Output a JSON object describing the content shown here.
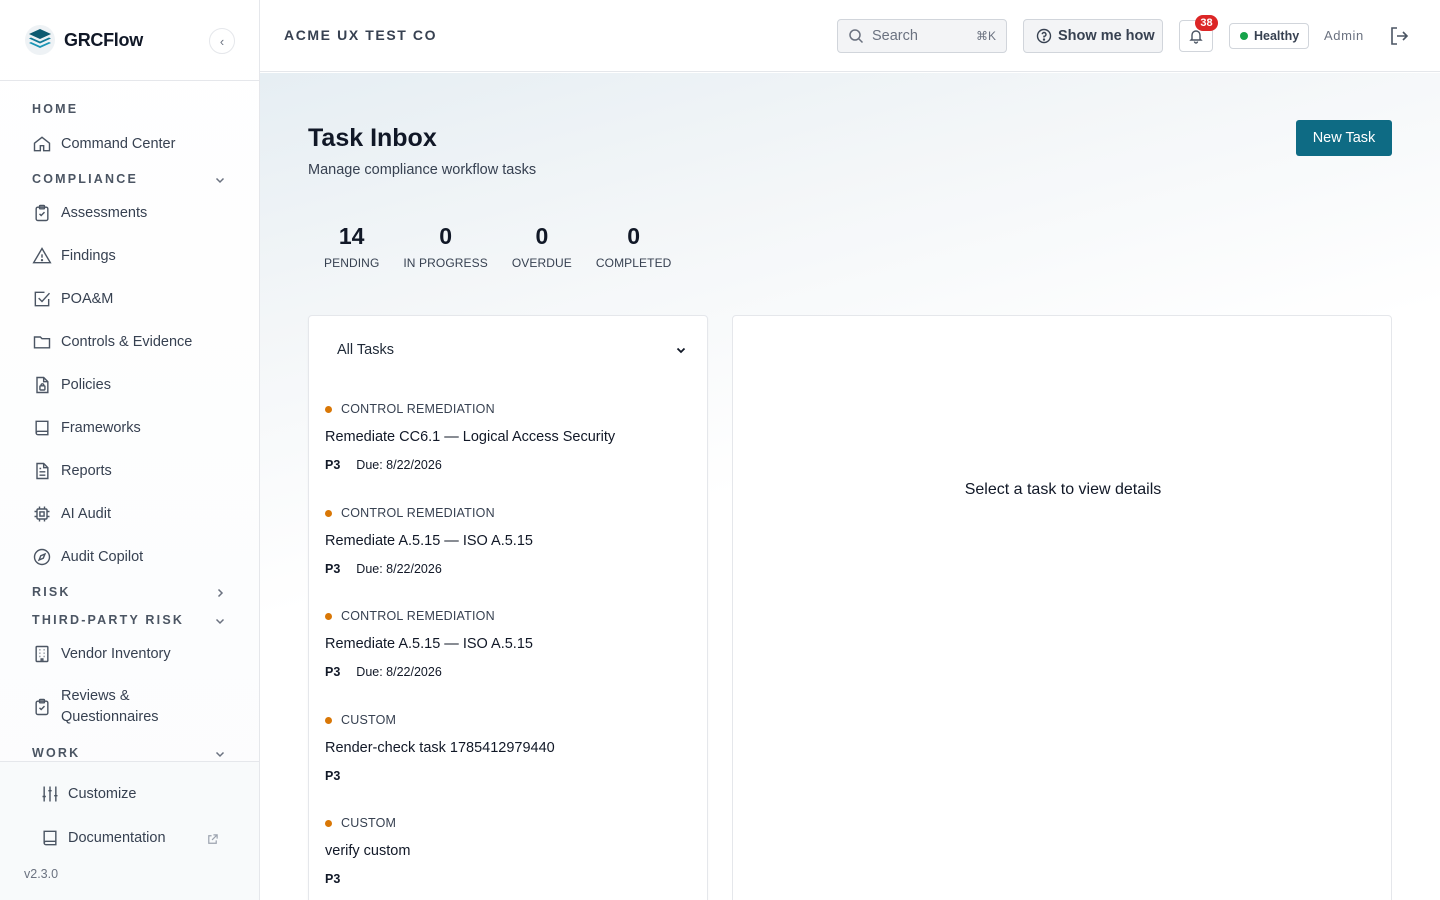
{
  "brand": {
    "name": "GRCFlow",
    "collapse_glyph": "‹"
  },
  "sidebar": {
    "sections": {
      "home": "HOME",
      "compliance": "COMPLIANCE",
      "risk": "RISK",
      "third_party": "THIRD-PARTY RISK",
      "work": "WORK"
    },
    "items": {
      "command_center": "Command Center",
      "assessments": "Assessments",
      "findings": "Findings",
      "poam": "POA&M",
      "controls": "Controls & Evidence",
      "policies": "Policies",
      "frameworks": "Frameworks",
      "reports": "Reports",
      "ai_audit": "AI Audit",
      "audit_copilot": "Audit Copilot",
      "vendor_inventory": "Vendor Inventory",
      "reviews_1": "Reviews &",
      "reviews_2": "Questionnaires"
    },
    "bottom": {
      "customize": "Customize",
      "documentation": "Documentation",
      "version": "v2.3.0"
    }
  },
  "header": {
    "org": "ACME UX TEST CO",
    "search_placeholder": "Search",
    "search_shortcut": "⌘K",
    "show_me_how": "Show me how",
    "notification_count": "38",
    "health": "Healthy",
    "user": "Admin"
  },
  "page": {
    "title": "Task Inbox",
    "subtitle": "Manage compliance workflow tasks",
    "new_task": "New Task"
  },
  "stats": [
    {
      "value": "14",
      "label": "PENDING"
    },
    {
      "value": "0",
      "label": "IN PROGRESS"
    },
    {
      "value": "0",
      "label": "OVERDUE"
    },
    {
      "value": "0",
      "label": "COMPLETED"
    }
  ],
  "filter": {
    "selected": "All Tasks"
  },
  "tasks": [
    {
      "type": "CONTROL REMEDIATION",
      "title": "Remediate CC6.1 — Logical Access Security",
      "priority": "P3",
      "due": "Due: 8/22/2026"
    },
    {
      "type": "CONTROL REMEDIATION",
      "title": "Remediate A.5.15 — ISO A.5.15",
      "priority": "P3",
      "due": "Due: 8/22/2026"
    },
    {
      "type": "CONTROL REMEDIATION",
      "title": "Remediate A.5.15 — ISO A.5.15",
      "priority": "P3",
      "due": "Due: 8/22/2026"
    },
    {
      "type": "CUSTOM",
      "title": "Render-check task 1785412979440",
      "priority": "P3",
      "due": ""
    },
    {
      "type": "CUSTOM",
      "title": "verify custom",
      "priority": "P3",
      "due": ""
    }
  ],
  "detail": {
    "empty": "Select a task to view details"
  },
  "colors": {
    "accent": "#0e6b84",
    "badge": "#dc2626",
    "healthy": "#16a34a",
    "task_dot": "#d97706"
  }
}
